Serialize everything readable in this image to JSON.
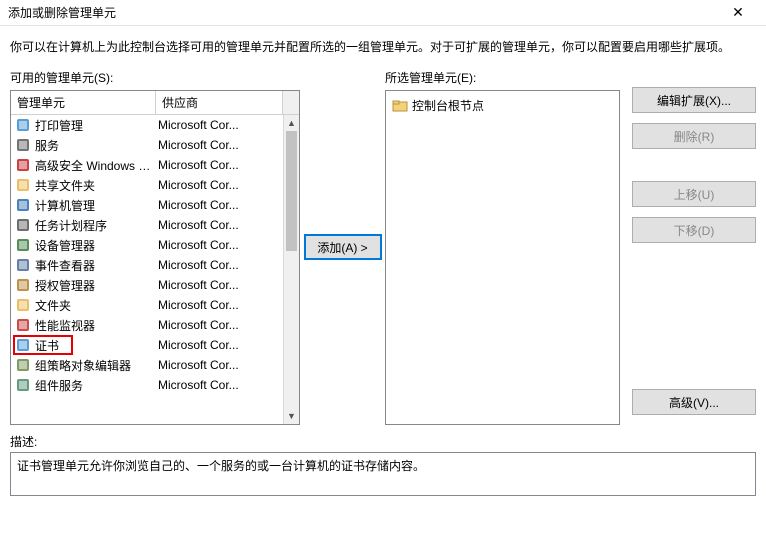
{
  "window": {
    "title": "添加或删除管理单元",
    "close_glyph": "✕"
  },
  "instruction": "你可以在计算机上为此控制台选择可用的管理单元并配置所选的一组管理单元。对于可扩展的管理单元，你可以配置要启用哪些扩展项。",
  "labels": {
    "available": "可用的管理单元(S):",
    "selected": "所选管理单元(E):",
    "description_label": "描述:"
  },
  "headers": {
    "name": "管理单元",
    "vendor": "供应商"
  },
  "snapins": [
    {
      "name": "打印管理",
      "vendor": "Microsoft Cor...",
      "icon": "printer"
    },
    {
      "name": "服务",
      "vendor": "Microsoft Cor...",
      "icon": "gear"
    },
    {
      "name": "高级安全 Windows De...",
      "vendor": "Microsoft Cor...",
      "icon": "shield"
    },
    {
      "name": "共享文件夹",
      "vendor": "Microsoft Cor...",
      "icon": "folder"
    },
    {
      "name": "计算机管理",
      "vendor": "Microsoft Cor...",
      "icon": "computer"
    },
    {
      "name": "任务计划程序",
      "vendor": "Microsoft Cor...",
      "icon": "clock"
    },
    {
      "name": "设备管理器",
      "vendor": "Microsoft Cor...",
      "icon": "device"
    },
    {
      "name": "事件查看器",
      "vendor": "Microsoft Cor...",
      "icon": "event"
    },
    {
      "name": "授权管理器",
      "vendor": "Microsoft Cor...",
      "icon": "key"
    },
    {
      "name": "文件夹",
      "vendor": "Microsoft Cor...",
      "icon": "folder2"
    },
    {
      "name": "性能监视器",
      "vendor": "Microsoft Cor...",
      "icon": "perf"
    },
    {
      "name": "证书",
      "vendor": "Microsoft Cor...",
      "icon": "cert",
      "highlight": true
    },
    {
      "name": "组策略对象编辑器",
      "vendor": "Microsoft Cor...",
      "icon": "policy"
    },
    {
      "name": "组件服务",
      "vendor": "Microsoft Cor...",
      "icon": "component"
    }
  ],
  "selected_tree": {
    "root": "控制台根节点"
  },
  "buttons": {
    "add": "添加(A) >",
    "edit_ext": "编辑扩展(X)...",
    "remove": "删除(R)",
    "move_up": "上移(U)",
    "move_down": "下移(D)",
    "advanced": "高级(V)..."
  },
  "description_text": "证书管理单元允许你浏览自己的、一个服务的或一台计算机的证书存储内容。",
  "icon_colors": {
    "printer": "#3a8dd0",
    "gear": "#5a5a5a",
    "shield": "#c02020",
    "folder": "#e8b44a",
    "computer": "#2a6db0",
    "clock": "#555",
    "device": "#3a7a3a",
    "event": "#4a6a9a",
    "key": "#b08030",
    "folder2": "#e8b44a",
    "perf": "#c03030",
    "cert": "#3a8dd0",
    "policy": "#6a8a4a",
    "component": "#4a8a6a"
  }
}
